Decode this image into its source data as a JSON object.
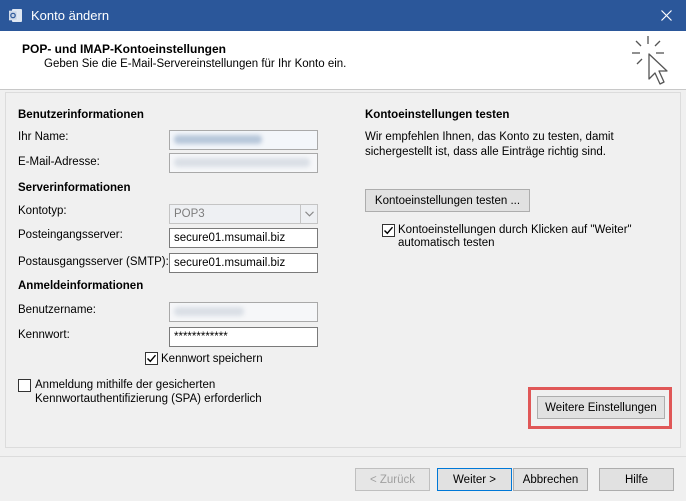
{
  "window": {
    "title": "Konto ändern"
  },
  "header": {
    "title": "POP- und IMAP-Kontoeinstellungen",
    "subtitle": "Geben Sie die E-Mail-Servereinstellungen für Ihr Konto ein."
  },
  "left": {
    "user_section": "Benutzerinformationen",
    "name_label": "Ihr Name:",
    "email_label": "E-Mail-Adresse:",
    "server_section": "Serverinformationen",
    "account_type_label": "Kontotyp:",
    "account_type_value": "POP3",
    "incoming_label": "Posteingangsserver:",
    "incoming_value": "secure01.msumail.biz",
    "outgoing_label": "Postausgangsserver (SMTP):",
    "outgoing_value": "secure01.msumail.biz",
    "login_section": "Anmeldeinformationen",
    "username_label": "Benutzername:",
    "password_label": "Kennwort:",
    "password_value": "************",
    "remember_password_label": "Kennwort speichern",
    "remember_password_checked": true,
    "spa_label_line1": "Anmeldung mithilfe der gesicherten",
    "spa_label_line2": "Kennwortauthentifizierung (SPA) erforderlich",
    "spa_checked": false
  },
  "right": {
    "test_section": "Kontoeinstellungen testen",
    "test_desc_line1": "Wir empfehlen Ihnen, das Konto zu testen, damit",
    "test_desc_line2": "sichergestellt ist, dass alle Einträge richtig sind.",
    "test_button": "Kontoeinstellungen testen ...",
    "auto_test_line1": "Kontoeinstellungen durch Klicken auf \"Weiter\"",
    "auto_test_line2": "automatisch testen",
    "auto_test_checked": true,
    "more_settings_button": "Weitere Einstellungen"
  },
  "footer": {
    "back_button": "< Zurück",
    "next_button": "Weiter >",
    "cancel_button": "Abbrechen",
    "help_button": "Hilfe"
  },
  "colors": {
    "titlebar": "#2b579a",
    "highlight": "#e05757",
    "default_button_border": "#0078d7"
  }
}
